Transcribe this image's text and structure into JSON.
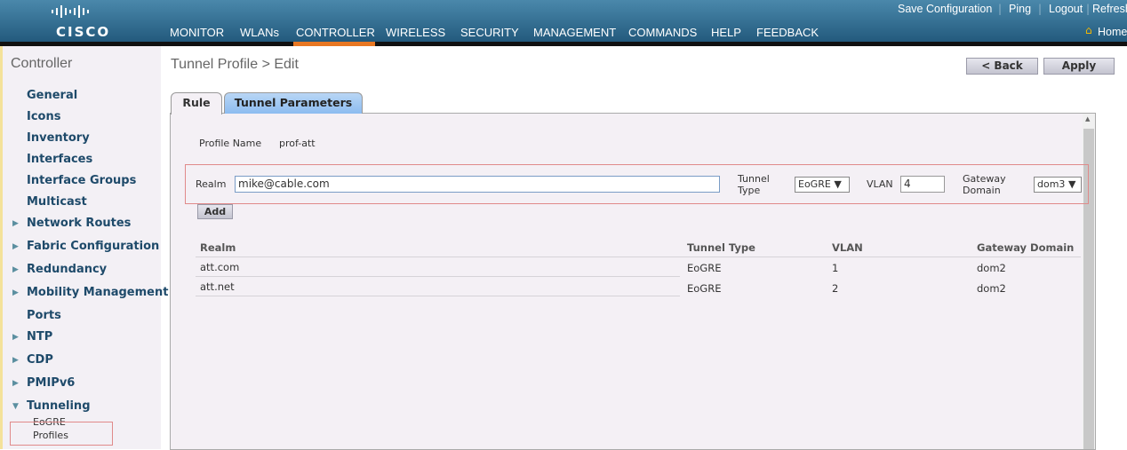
{
  "header": {
    "logo": "CISCO",
    "nav": [
      {
        "label": "MONITOR",
        "active": false
      },
      {
        "label": "WLANs",
        "active": false
      },
      {
        "label": "CONTROLLER",
        "active": true
      },
      {
        "label": "WIRELESS",
        "active": false
      },
      {
        "label": "SECURITY",
        "active": false
      },
      {
        "label": "MANAGEMENT",
        "active": false
      },
      {
        "label": "COMMANDS",
        "active": false
      },
      {
        "label": "HELP",
        "active": false
      },
      {
        "label": "FEEDBACK",
        "active": false
      }
    ],
    "top_links": [
      "Save Configuration",
      "Ping",
      "Logout",
      "Refresh"
    ],
    "home": "Home",
    "accent": "#e87722"
  },
  "sidebar": {
    "title": "Controller",
    "items": [
      {
        "label": "General"
      },
      {
        "label": "Icons"
      },
      {
        "label": "Inventory"
      },
      {
        "label": "Interfaces"
      },
      {
        "label": "Interface Groups"
      },
      {
        "label": "Multicast"
      },
      {
        "label": "Network Routes",
        "expander": "collapsed"
      },
      {
        "label": "Fabric Configuration",
        "expander": "collapsed"
      },
      {
        "label": "Redundancy",
        "expander": "collapsed"
      },
      {
        "label": "Mobility Management",
        "expander": "collapsed"
      },
      {
        "label": "Ports"
      },
      {
        "label": "NTP",
        "expander": "collapsed"
      },
      {
        "label": "CDP",
        "expander": "collapsed"
      },
      {
        "label": "PMIPv6",
        "expander": "collapsed"
      },
      {
        "label": "Tunneling",
        "expander": "expanded"
      }
    ],
    "sub_items": [
      "EoGRE",
      "Profiles"
    ]
  },
  "main": {
    "title": "Tunnel Profile > Edit",
    "back_label": "< Back",
    "apply_label": "Apply",
    "tabs": [
      {
        "label": "Rule",
        "active": true
      },
      {
        "label": "Tunnel Parameters",
        "active": false
      }
    ],
    "profile_name_label": "Profile Name",
    "profile_name": "prof-att",
    "form": {
      "realm_label": "Realm",
      "realm_value": "mike@cable.com",
      "tunnel_type_label": "Tunnel Type",
      "tunnel_type_l1": "Tunnel",
      "tunnel_type_l2": "Type",
      "tunnel_type_value": "EoGRE",
      "vlan_label": "VLAN",
      "vlan_value": "4",
      "gateway_label_l1": "Gateway",
      "gateway_label_l2": "Domain",
      "gateway_value": "dom3",
      "add_label": "Add"
    },
    "table": {
      "headers": [
        "Realm",
        "Tunnel Type",
        "VLAN",
        "Gateway Domain"
      ],
      "rows": [
        [
          "att.com",
          "EoGRE",
          "1",
          "dom2"
        ],
        [
          "att.net",
          "EoGRE",
          "2",
          "dom2"
        ]
      ]
    }
  }
}
